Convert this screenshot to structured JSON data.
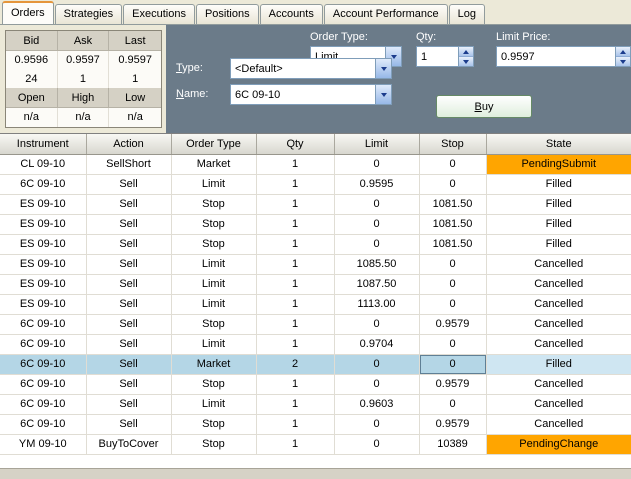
{
  "tabs": [
    {
      "label": "Orders",
      "active": true
    },
    {
      "label": "Strategies",
      "active": false
    },
    {
      "label": "Executions",
      "active": false
    },
    {
      "label": "Positions",
      "active": false
    },
    {
      "label": "Accounts",
      "active": false
    },
    {
      "label": "Account Performance",
      "active": false
    },
    {
      "label": "Log",
      "active": false
    }
  ],
  "quote_panel": {
    "headers_top": [
      "Bid",
      "Ask",
      "Last"
    ],
    "price_row": [
      "0.9596",
      "0.9597",
      "0.9597"
    ],
    "size_row": [
      "24",
      "1",
      "1"
    ],
    "headers_bottom": [
      "Open",
      "High",
      "Low"
    ],
    "ohl_row": [
      "n/a",
      "n/a",
      "n/a"
    ]
  },
  "order_entry": {
    "type_label": "Type:",
    "type_value": "<Default>",
    "name_label": "Name:",
    "name_value": "6C 09-10",
    "order_type_label": "Order Type:",
    "order_type_value": "Limit",
    "qty_label": "Qty:",
    "qty_value": "1",
    "limit_price_label": "Limit Price:",
    "limit_price_value": "0.9597",
    "buy_button_label": "Buy"
  },
  "orders_table": {
    "columns": [
      "Instrument",
      "Action",
      "Order Type",
      "Qty",
      "Limit",
      "Stop",
      "State"
    ],
    "rows": [
      {
        "instrument": "CL 09-10",
        "action": "SellShort",
        "order_type": "Market",
        "qty": "1",
        "limit": "0",
        "stop": "0",
        "state": "PendingSubmit",
        "state_bg": "#ffa500",
        "selected": false
      },
      {
        "instrument": "6C 09-10",
        "action": "Sell",
        "order_type": "Limit",
        "qty": "1",
        "limit": "0.9595",
        "stop": "0",
        "state": "Filled",
        "state_bg": "",
        "selected": false
      },
      {
        "instrument": "ES 09-10",
        "action": "Sell",
        "order_type": "Stop",
        "qty": "1",
        "limit": "0",
        "stop": "1081.50",
        "state": "Filled",
        "state_bg": "",
        "selected": false
      },
      {
        "instrument": "ES 09-10",
        "action": "Sell",
        "order_type": "Stop",
        "qty": "1",
        "limit": "0",
        "stop": "1081.50",
        "state": "Filled",
        "state_bg": "",
        "selected": false
      },
      {
        "instrument": "ES 09-10",
        "action": "Sell",
        "order_type": "Stop",
        "qty": "1",
        "limit": "0",
        "stop": "1081.50",
        "state": "Filled",
        "state_bg": "",
        "selected": false
      },
      {
        "instrument": "ES 09-10",
        "action": "Sell",
        "order_type": "Limit",
        "qty": "1",
        "limit": "1085.50",
        "stop": "0",
        "state": "Cancelled",
        "state_bg": "",
        "selected": false
      },
      {
        "instrument": "ES 09-10",
        "action": "Sell",
        "order_type": "Limit",
        "qty": "1",
        "limit": "1087.50",
        "stop": "0",
        "state": "Cancelled",
        "state_bg": "",
        "selected": false
      },
      {
        "instrument": "ES 09-10",
        "action": "Sell",
        "order_type": "Limit",
        "qty": "1",
        "limit": "1113.00",
        "stop": "0",
        "state": "Cancelled",
        "state_bg": "",
        "selected": false
      },
      {
        "instrument": "6C 09-10",
        "action": "Sell",
        "order_type": "Stop",
        "qty": "1",
        "limit": "0",
        "stop": "0.9579",
        "state": "Cancelled",
        "state_bg": "",
        "selected": false
      },
      {
        "instrument": "6C 09-10",
        "action": "Sell",
        "order_type": "Limit",
        "qty": "1",
        "limit": "0.9704",
        "stop": "0",
        "state": "Cancelled",
        "state_bg": "",
        "selected": false
      },
      {
        "instrument": "6C 09-10",
        "action": "Sell",
        "order_type": "Market",
        "qty": "2",
        "limit": "0",
        "stop": "0",
        "state": "Filled",
        "state_bg": "#cfe6f2",
        "selected": true
      },
      {
        "instrument": "6C 09-10",
        "action": "Sell",
        "order_type": "Stop",
        "qty": "1",
        "limit": "0",
        "stop": "0.9579",
        "state": "Cancelled",
        "state_bg": "",
        "selected": false
      },
      {
        "instrument": "6C 09-10",
        "action": "Sell",
        "order_type": "Limit",
        "qty": "1",
        "limit": "0.9603",
        "stop": "0",
        "state": "Cancelled",
        "state_bg": "",
        "selected": false
      },
      {
        "instrument": "6C 09-10",
        "action": "Sell",
        "order_type": "Stop",
        "qty": "1",
        "limit": "0",
        "stop": "0.9579",
        "state": "Cancelled",
        "state_bg": "",
        "selected": false
      },
      {
        "instrument": "YM 09-10",
        "action": "BuyToCover",
        "order_type": "Stop",
        "qty": "1",
        "limit": "0",
        "stop": "10389",
        "state": "PendingChange",
        "state_bg": "#ffa500",
        "selected": false
      }
    ]
  },
  "colors": {
    "pending_state": "#ffa500",
    "selected_row": "#b4d6e6",
    "panel_background": "#6b7b89",
    "tab_strip_background": "#ece9d8"
  }
}
